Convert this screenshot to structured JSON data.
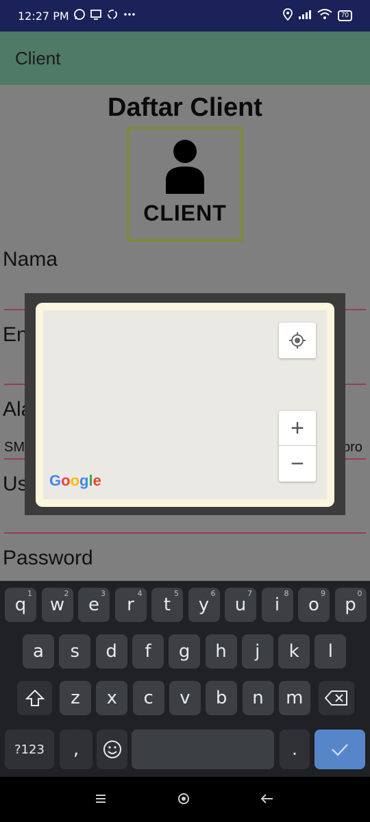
{
  "status_bar": {
    "time": "12:27 PM",
    "left_icons": [
      "whatsapp-icon",
      "screen-icon",
      "sync-icon",
      "more-icon"
    ],
    "right_icons": [
      "location-icon",
      "signal-icon",
      "wifi-icon"
    ],
    "battery": "70"
  },
  "app_bar": {
    "title": "Client"
  },
  "form": {
    "heading": "Daftar Client",
    "logo_label": "CLIENT",
    "labels": {
      "nama": "Nama",
      "email": "En",
      "alamat": "Ala",
      "alamat_value_left": "SM",
      "alamat_value_right": "pro",
      "username": "Us",
      "password": "Password"
    }
  },
  "map_dialog": {
    "google_logo": "Google",
    "zoom_in": "+",
    "zoom_out": "−"
  },
  "keyboard": {
    "row1": [
      {
        "k": "q",
        "h": "1"
      },
      {
        "k": "w",
        "h": "2"
      },
      {
        "k": "e",
        "h": "3"
      },
      {
        "k": "r",
        "h": "4"
      },
      {
        "k": "t",
        "h": "5"
      },
      {
        "k": "y",
        "h": "6"
      },
      {
        "k": "u",
        "h": "7"
      },
      {
        "k": "i",
        "h": "8"
      },
      {
        "k": "o",
        "h": "9"
      },
      {
        "k": "p",
        "h": "0"
      }
    ],
    "row2": [
      "a",
      "s",
      "d",
      "f",
      "g",
      "h",
      "j",
      "k",
      "l"
    ],
    "row3": [
      "z",
      "x",
      "c",
      "v",
      "b",
      "n",
      "m"
    ],
    "symbols_label": "?123",
    "comma": ",",
    "period": "."
  },
  "colors": {
    "status_bar": "#1b2159",
    "app_bar": "#4e7a66",
    "accent_line": "#9b3a52",
    "logo_border": "#7c8a3a",
    "action_key": "#5685c9"
  }
}
